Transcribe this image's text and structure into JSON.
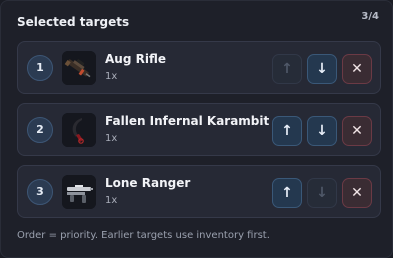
{
  "header": {
    "title": "Selected targets",
    "counter": "3/4"
  },
  "targets": [
    {
      "index": "1",
      "name": "Aug Rifle",
      "quantity": "1x",
      "icon": "aug-rifle-icon",
      "can_move_up": false,
      "can_move_down": true
    },
    {
      "index": "2",
      "name": "Fallen Infernal Karambit",
      "quantity": "1x",
      "icon": "karambit-knife-icon",
      "can_move_up": true,
      "can_move_down": true
    },
    {
      "index": "3",
      "name": "Lone Ranger",
      "quantity": "1x",
      "icon": "lone-ranger-gun-icon",
      "can_move_up": true,
      "can_move_down": false
    }
  ],
  "buttons": {
    "up_glyph": "↑",
    "down_glyph": "↓",
    "remove_glyph": "✕"
  },
  "footer": {
    "note": "Order = priority. Earlier targets use inventory first."
  },
  "colors": {
    "accent": "#3a5878",
    "remove": "#6b3a45",
    "background": "#1e2029"
  }
}
